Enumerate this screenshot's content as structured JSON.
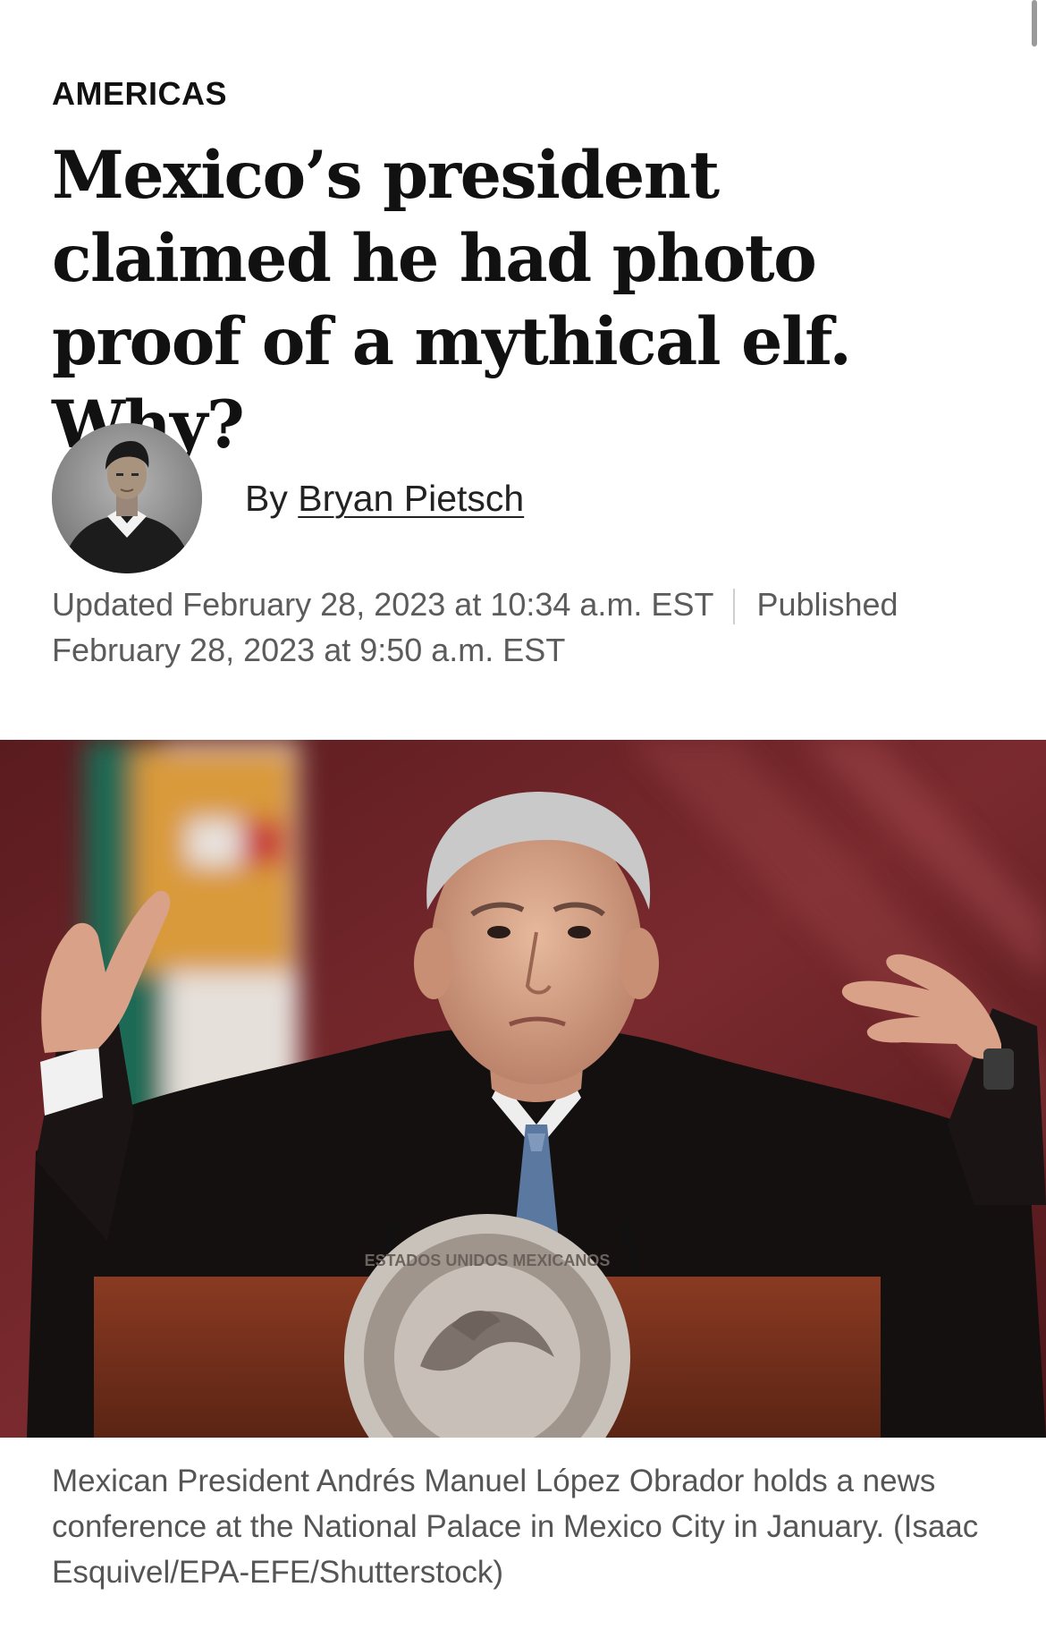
{
  "article": {
    "kicker": "AMERICAS",
    "headline": "Mexico’s president claimed he had photo proof of a mythical elf. Why?",
    "byline_prefix": "By",
    "author": "Bryan Pietsch",
    "updated": "Updated February 28, 2023 at 10:34 a.m. EST",
    "published": "Published February 28, 2023 at 9:50 a.m. EST",
    "photo_caption": "Mexican President Andrés Manuel López Obrador holds a news conference at the National Palace in Mexico City in January. (Isaac Esquivel/EPA-EFE/Shutterstock)"
  },
  "photo": {
    "seal_text": "ESTADOS UNIDOS MEXICANOS"
  },
  "icons": {
    "scroll_indicator": "scrollbar",
    "avatar": "author-avatar"
  },
  "colors": {
    "text": "#111111",
    "meta_text": "#5b5b5b",
    "caption_text": "#555555",
    "background": "#ffffff"
  }
}
